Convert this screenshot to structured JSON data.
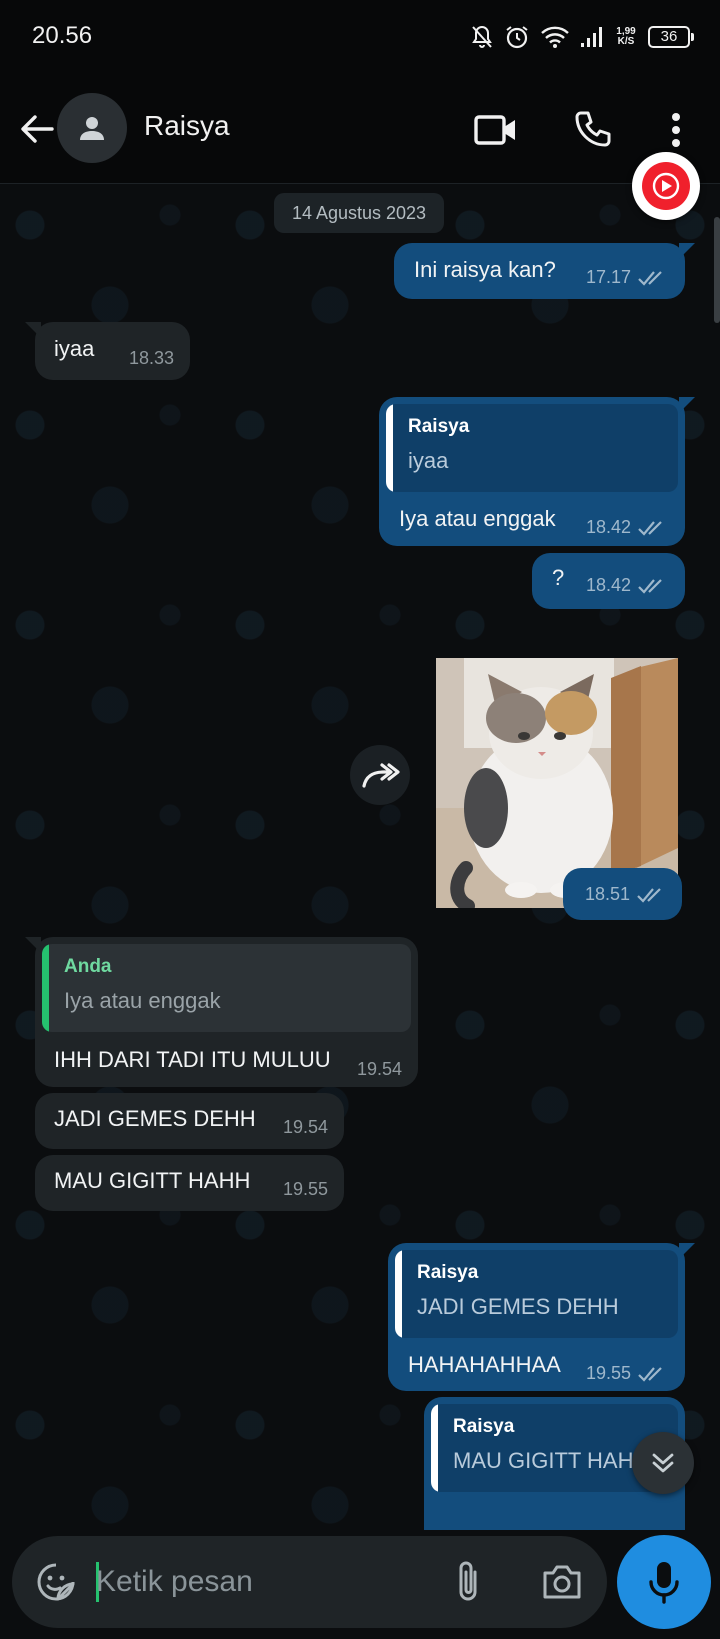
{
  "status_bar": {
    "time": "20.56",
    "net_speed_value": "1,99",
    "net_speed_unit": "K/S",
    "battery": "36",
    "icons": [
      "mute-bell-icon",
      "alarm-icon",
      "wifi-icon",
      "signal-icon",
      "battery-icon"
    ]
  },
  "header": {
    "contact_name": "Raisya",
    "icons": [
      "back-arrow-icon",
      "avatar-person-icon",
      "video-call-icon",
      "voice-call-icon",
      "more-vertical-icon"
    ]
  },
  "floating_badge_icon": "youtube-music-icon",
  "chat": {
    "date_separator": "14 Agustus 2023",
    "messages": [
      {
        "direction": "out",
        "text": "Ini raisya kan?",
        "time": "17.17",
        "status": "read"
      },
      {
        "direction": "in",
        "text": "iyaa",
        "time": "18.33"
      },
      {
        "direction": "out",
        "quote": {
          "name": "Raisya",
          "text": "iyaa"
        },
        "text": "Iya atau enggak",
        "time": "18.42",
        "status": "read"
      },
      {
        "direction": "out",
        "text": "?",
        "time": "18.42",
        "status": "read"
      },
      {
        "direction": "out",
        "type": "image",
        "image_desc": "cat-photo",
        "time": "18.51",
        "status": "read"
      },
      {
        "direction": "in",
        "quote": {
          "name": "Anda",
          "text": "Iya atau enggak"
        },
        "text": "IHH DARI TADI ITU MULUU",
        "time": "19.54"
      },
      {
        "direction": "in",
        "text": "JADI GEMES DEHH",
        "time": "19.54"
      },
      {
        "direction": "in",
        "text": "MAU GIGITT HAHH",
        "time": "19.55"
      },
      {
        "direction": "out",
        "quote": {
          "name": "Raisya",
          "text": "JADI GEMES DEHH"
        },
        "text": "HAHAHAHHAA",
        "time": "19.55",
        "status": "read"
      },
      {
        "direction": "out",
        "quote": {
          "name": "Raisya",
          "text": "MAU GIGITT HAHH"
        },
        "text": "",
        "partial": true
      }
    ]
  },
  "input": {
    "placeholder": "Ketik pesan",
    "icons": [
      "sticker-emoji-icon",
      "attach-paperclip-icon",
      "camera-icon",
      "microphone-icon"
    ]
  },
  "colors": {
    "outgoing_bubble": "#134d7d",
    "incoming_bubble": "#1f2427",
    "accent_green": "#25c16f",
    "mic_button": "#1f8de0",
    "background": "#0b0d0f"
  }
}
